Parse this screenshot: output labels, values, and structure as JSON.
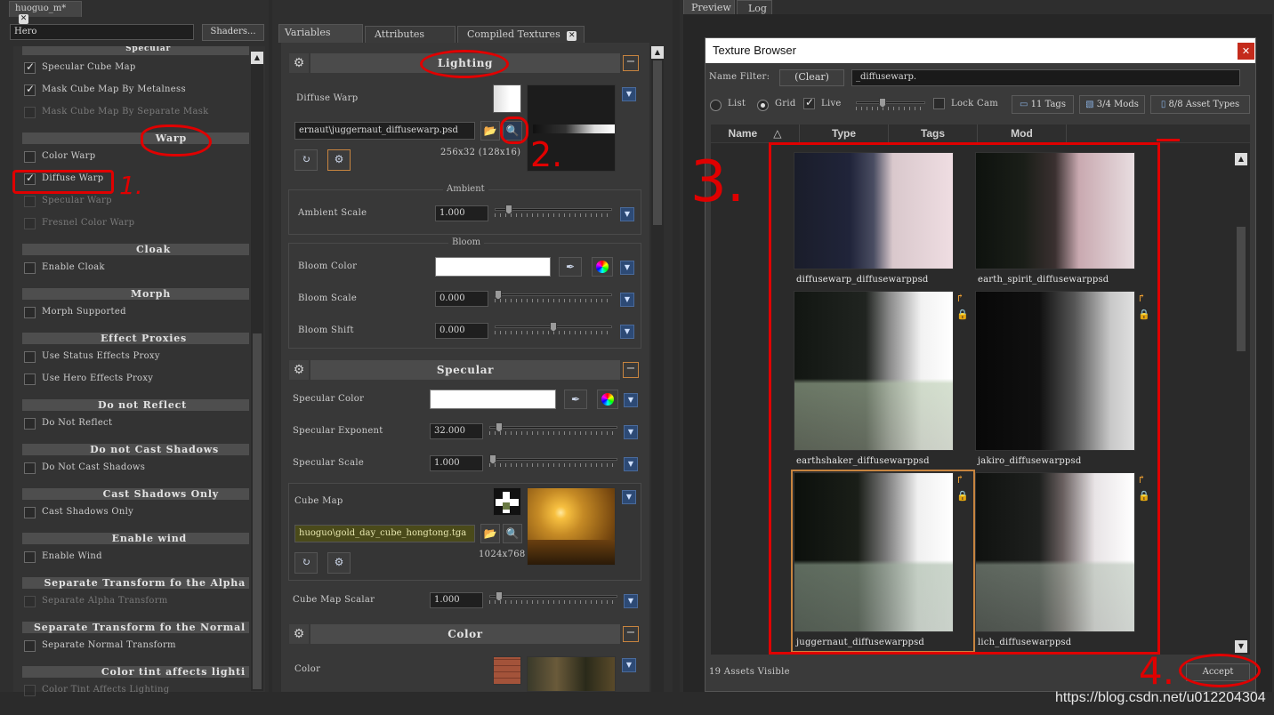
{
  "left": {
    "file_tab": "huoguo_m*",
    "name_field": "Hero",
    "shaders_btn": "Shaders...",
    "top_section": "Specular",
    "items": [
      {
        "label": "Specular Cube Map",
        "checked": true,
        "disabled": false
      },
      {
        "label": "Mask Cube Map By Metalness",
        "checked": true,
        "disabled": false
      },
      {
        "label": "Mask Cube Map By Separate Mask",
        "checked": false,
        "disabled": true
      }
    ],
    "warp_title": "Warp",
    "warp_items": [
      {
        "label": "Color Warp",
        "checked": false,
        "disabled": false
      },
      {
        "label": "Diffuse Warp",
        "checked": true,
        "disabled": false
      },
      {
        "label": "Specular Warp",
        "checked": false,
        "disabled": true
      },
      {
        "label": "Fresnel Color Warp",
        "checked": false,
        "disabled": true
      }
    ],
    "sections": [
      {
        "title": "Cloak",
        "item": "Enable Cloak",
        "disabled": false
      },
      {
        "title": "Morph",
        "item": "Morph Supported",
        "disabled": false
      },
      {
        "title": "Effect Proxies",
        "item": "Use Status Effects Proxy",
        "item2": "Use Hero Effects Proxy",
        "disabled": false
      },
      {
        "title": "Do not Reflect",
        "item": "Do Not Reflect",
        "disabled": false
      },
      {
        "title": "Do not Cast Shadows",
        "item": "Do Not Cast Shadows",
        "disabled": false
      },
      {
        "title": "Cast Shadows Only",
        "item": "Cast Shadows Only",
        "disabled": false
      },
      {
        "title": "Enable wind",
        "item": "Enable Wind",
        "disabled": false
      },
      {
        "title": "Separate Transform fo the Alpha",
        "item": "Separate Alpha Transform",
        "disabled": true
      },
      {
        "title": "Separate Transform fo the Normal",
        "item": "Separate Normal Transform",
        "disabled": false
      },
      {
        "title": "Color tint affects lighti",
        "item": "Color Tint Affects Lighting",
        "disabled": true
      }
    ]
  },
  "middle": {
    "tabs": [
      "Variables",
      "Attributes",
      "Compiled Textures"
    ],
    "lighting_title": "Lighting",
    "diffuse_warp_label": "Diffuse Warp",
    "diffuse_warp_path": "ernaut\\juggernaut_diffusewarp.psd",
    "diffuse_warp_size": "256x32 (128x16)",
    "ambient_title": "Ambient",
    "ambient_scale_label": "Ambient Scale",
    "ambient_scale": "1.000",
    "bloom_title": "Bloom",
    "bloom_color_label": "Bloom Color",
    "bloom_scale_label": "Bloom Scale",
    "bloom_scale": "0.000",
    "bloom_shift_label": "Bloom Shift",
    "bloom_shift": "0.000",
    "specular_title": "Specular",
    "specular_color_label": "Specular Color",
    "specular_exponent_label": "Specular Exponent",
    "specular_exponent": "32.000",
    "specular_scale_label": "Specular Scale",
    "specular_scale": "1.000",
    "cube_map_label": "Cube Map",
    "cube_map_path": "huoguo\\gold_day_cube_hongtong.tga",
    "cube_map_size": "1024x768",
    "cube_map_scalar_label": "Cube Map Scalar",
    "cube_map_scalar": "1.000",
    "color_title": "Color",
    "color_label": "Color"
  },
  "right": {
    "tabs": [
      "Preview",
      "Log"
    ],
    "dialog_title": "Texture Browser",
    "name_filter_label": "Name Filter:",
    "clear_btn": "(Clear)",
    "filter_value": "_diffusewarp.",
    "view_list": "List",
    "view_grid": "Grid",
    "live_label": "Live",
    "lock_cam_label": "Lock Cam",
    "tags_btn": "11 Tags",
    "mods_btn": "3/4 Mods",
    "asset_types_btn": "8/8 Asset Types",
    "columns": [
      "Name",
      "Type",
      "Tags",
      "Mod"
    ],
    "thumbs": [
      "diffusewarp_diffusewarppsd",
      "earth_spirit_diffusewarppsd",
      "earthshaker_diffusewarppsd",
      "jakiro_diffusewarppsd",
      "juggernaut_diffusewarppsd",
      "lich_diffusewarppsd"
    ],
    "assets_visible": "19 Assets Visible",
    "accept_btn": "Accept"
  },
  "annotations": [
    "1.",
    "2.",
    "3.",
    "4."
  ],
  "watermark": "https://blog.csdn.net/u012204304",
  "colors": {
    "highlight_red": "#e00000",
    "selection_orange": "#c7843f",
    "dropdown_blue": "#2d4a75"
  }
}
